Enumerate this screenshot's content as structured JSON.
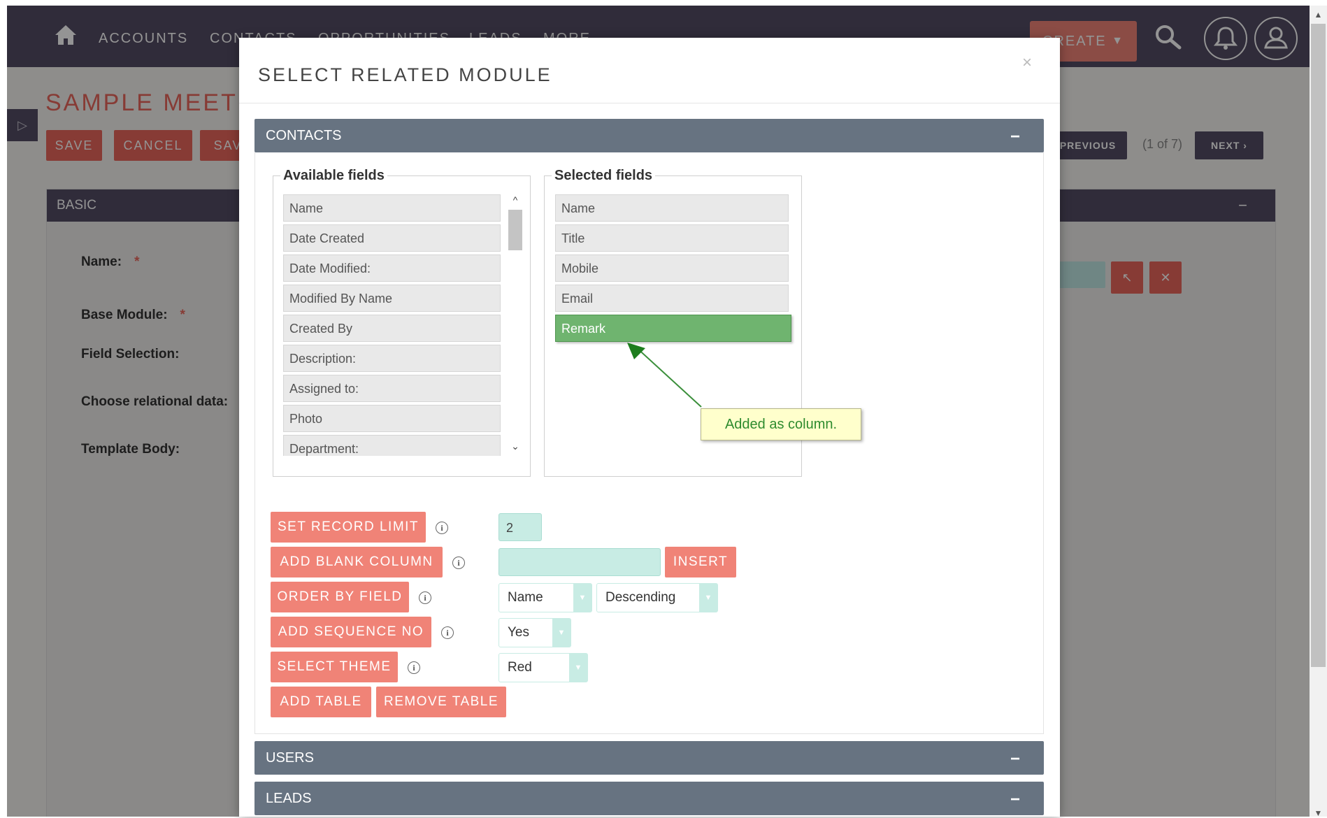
{
  "nav": {
    "items": [
      "ACCOUNTS",
      "CONTACTS",
      "OPPORTUNITIES",
      "LEADS",
      "MORE"
    ],
    "create_label": "CREATE"
  },
  "page": {
    "title": "SAMPLE MEETING",
    "buttons": {
      "save": "SAVE",
      "cancel": "CANCEL",
      "save_more": "SAV"
    },
    "previous": "PREVIOUS",
    "pager": "(1 of 7)",
    "next": "NEXT",
    "panel_title": "BASIC",
    "fields": {
      "name": "Name:",
      "base_module": "Base Module:",
      "field_selection": "Field Selection:",
      "relational": "Choose relational data:",
      "template_body": "Template Body:",
      "required_mark": "*"
    }
  },
  "modal": {
    "title": "SELECT RELATED MODULE",
    "close": "×",
    "sections": [
      {
        "label": "CONTACTS",
        "toggle": "−"
      },
      {
        "label": "USERS",
        "toggle": "−"
      },
      {
        "label": "LEADS",
        "toggle": "−"
      }
    ],
    "available": {
      "legend": "Available fields",
      "items": [
        "Name",
        "Date Created",
        "Date Modified:",
        "Modified By Name",
        "Created By",
        "Description:",
        "Assigned to:",
        "Photo",
        "Department:"
      ]
    },
    "selected": {
      "legend": "Selected fields",
      "items": [
        "Name",
        "Title",
        "Mobile",
        "Email",
        "Remark"
      ]
    },
    "tooltip": "Added as column.",
    "options": {
      "record_limit": {
        "label": "SET RECORD LIMIT",
        "value": "2"
      },
      "blank_column": {
        "label": "ADD BLANK COLUMN",
        "value": "",
        "insert": "INSERT"
      },
      "order_by": {
        "label": "ORDER BY FIELD",
        "field": "Name",
        "direction": "Descending"
      },
      "sequence": {
        "label": "ADD SEQUENCE NO",
        "value": "Yes"
      },
      "theme": {
        "label": "SELECT THEME",
        "value": "Red"
      },
      "add_table": "ADD TABLE",
      "remove_table": "REMOVE TABLE",
      "info_glyph": "i"
    }
  }
}
